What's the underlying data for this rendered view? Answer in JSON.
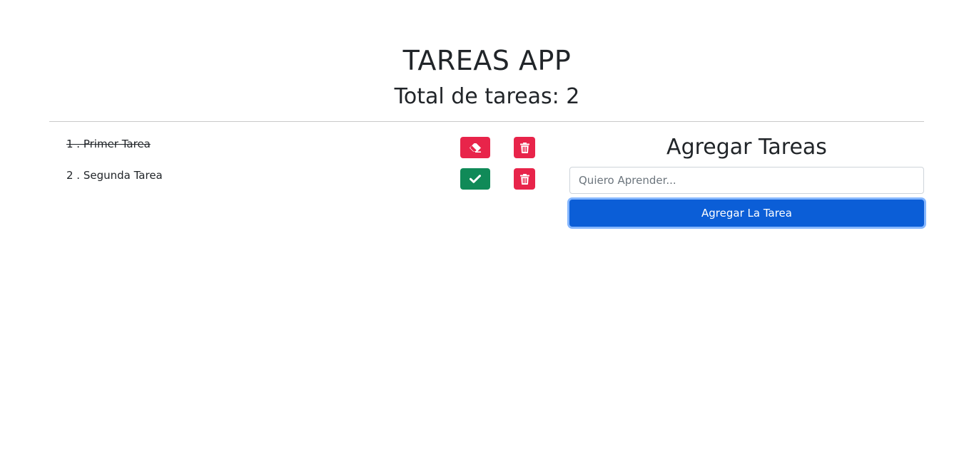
{
  "header": {
    "title": "TAREAS APP",
    "total_label": "Total de tareas: 2"
  },
  "tasks": [
    {
      "text": "1 . Primer Tarea",
      "completed": true,
      "toggle_icon": "eraser-icon",
      "delete_icon": "trash-icon"
    },
    {
      "text": "2 . Segunda Tarea",
      "completed": false,
      "toggle_icon": "check-icon",
      "delete_icon": "trash-icon"
    }
  ],
  "add_form": {
    "title": "Agregar Tareas",
    "placeholder": "Quiero Aprender...",
    "value": "",
    "button_label": "Agregar La Tarea"
  },
  "colors": {
    "danger": "#e8244a",
    "success": "#108a58",
    "primary": "#0b5ed7"
  }
}
